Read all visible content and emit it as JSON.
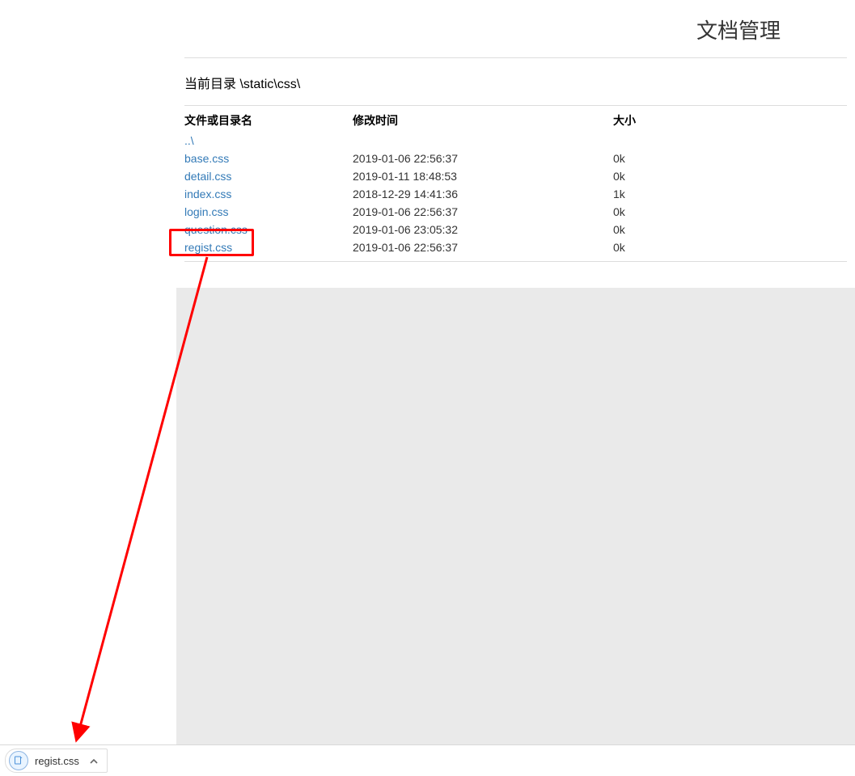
{
  "page": {
    "title": "文档管理",
    "current_dir_label": "当前目录",
    "current_dir_path": "\\static\\css\\"
  },
  "columns": {
    "name": "文件或目录名",
    "modified": "修改时间",
    "size": "大小"
  },
  "parent_dir": "..\\",
  "files": [
    {
      "name": "base.css",
      "modified": "2019-01-06 22:56:37",
      "size": "0k",
      "highlighted": false
    },
    {
      "name": "detail.css",
      "modified": "2019-01-11 18:48:53",
      "size": "0k",
      "highlighted": false
    },
    {
      "name": "index.css",
      "modified": "2018-12-29 14:41:36",
      "size": "1k",
      "highlighted": false
    },
    {
      "name": "login.css",
      "modified": "2019-01-06 22:56:37",
      "size": "0k",
      "highlighted": false
    },
    {
      "name": "question.css",
      "modified": "2019-01-06 23:05:32",
      "size": "0k",
      "highlighted": false
    },
    {
      "name": "regist.css",
      "modified": "2019-01-06 22:56:37",
      "size": "0k",
      "highlighted": true
    }
  ],
  "annotation": {
    "arrow_color": "#ff0000",
    "box_target_file": "regist.css"
  },
  "download_bar": {
    "file_name": "regist.css",
    "icon": "css-file-icon"
  }
}
